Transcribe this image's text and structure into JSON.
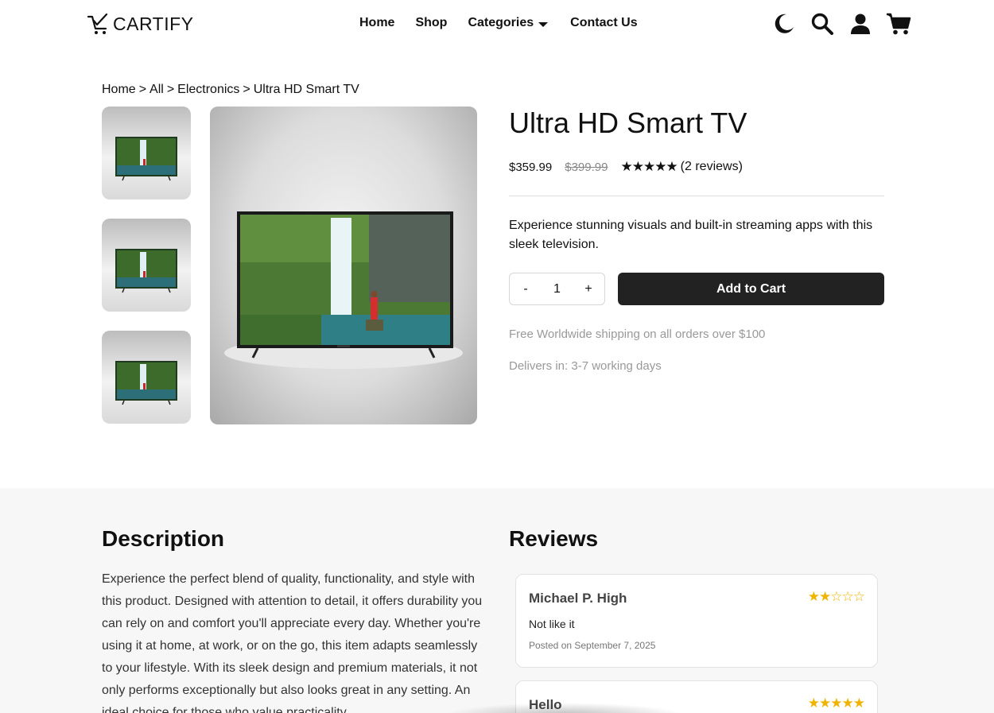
{
  "brand": {
    "name": "CARTIFY"
  },
  "nav": {
    "links": [
      "Home",
      "Shop",
      "Categories",
      "Contact Us"
    ]
  },
  "icons": {
    "theme": "moon-icon",
    "search": "search-icon",
    "account": "user-icon",
    "cart": "cart-icon"
  },
  "breadcrumb": {
    "items": [
      "Home",
      "All",
      "Electronics",
      "Ultra HD Smart TV"
    ],
    "separator": ">"
  },
  "product": {
    "title": "Ultra HD Smart TV",
    "price": "$359.99",
    "old_price": "$399.99",
    "rating_stars": "★★★★★",
    "rating_value": 5,
    "review_count": "(2 reviews)",
    "short_description": "Experience stunning visuals and built-in streaming apps with this sleek television.",
    "quantity": "1",
    "qty_minus": "-",
    "qty_plus": "+",
    "add_to_cart": "Add to Cart",
    "shipping_note": "Free Worldwide shipping on all orders over $100",
    "delivery_note": "Delivers in: 3-7 working days"
  },
  "description": {
    "title": "Description",
    "body": "Experience the perfect blend of quality, functionality, and style with this product. Designed with attention to detail, it offers durability you can rely on and comfort you'll appreciate every day. Whether you're using it at home, at work, or on the go, this item adapts seamlessly to your lifestyle. With its sleek design and premium materials, it not only performs exceptionally but also looks great in any setting. An ideal choice for those who value practicality"
  },
  "reviews": {
    "title": "Reviews",
    "items": [
      {
        "name": "Michael P. High",
        "stars": "★★☆☆☆",
        "rating": 2,
        "text": "Not like it",
        "date": "Posted on September 7, 2025"
      },
      {
        "name": "Hello",
        "stars": "★★★★★",
        "rating": 5
      }
    ]
  },
  "colors": {
    "accent_dark": "#222222",
    "star_gold": "#f0b400",
    "muted_text": "#999999"
  }
}
